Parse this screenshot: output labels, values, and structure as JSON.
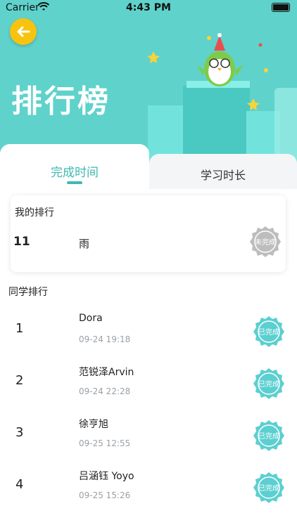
{
  "status_bar": {
    "carrier": "Carrier",
    "time": "4:43 PM"
  },
  "header": {
    "title": "排行榜"
  },
  "tabs": [
    {
      "label": "完成时间",
      "active": true
    },
    {
      "label": "学习时长",
      "active": false
    }
  ],
  "my_rank": {
    "section_title": "我的排行",
    "rank": "11",
    "name": "雨",
    "badge": "未完成"
  },
  "classmates": {
    "section_title": "同学排行",
    "rows": [
      {
        "rank": "1",
        "name": "Dora",
        "time": "09-24 19:18",
        "badge": "已完成"
      },
      {
        "rank": "2",
        "name": "范锐泽Arvin",
        "time": "09-24 22:28",
        "badge": "已完成"
      },
      {
        "rank": "3",
        "name": "徐亨旭",
        "time": "09-25 12:55",
        "badge": "已完成"
      },
      {
        "rank": "4",
        "name": "吕涵钰 Yoyo",
        "time": "09-25 15:26",
        "badge": "已完成"
      }
    ]
  },
  "colors": {
    "teal": "#5fd2cb",
    "accent": "#3fb8b2",
    "back_button": "#f8c30f",
    "badge_done": "#5ccfd0",
    "badge_pending": "#b8b8b8"
  },
  "icons": {
    "back": "arrow-left-icon",
    "wifi": "wifi-icon",
    "battery": "battery-icon",
    "mascot": "owl-mascot-icon"
  }
}
